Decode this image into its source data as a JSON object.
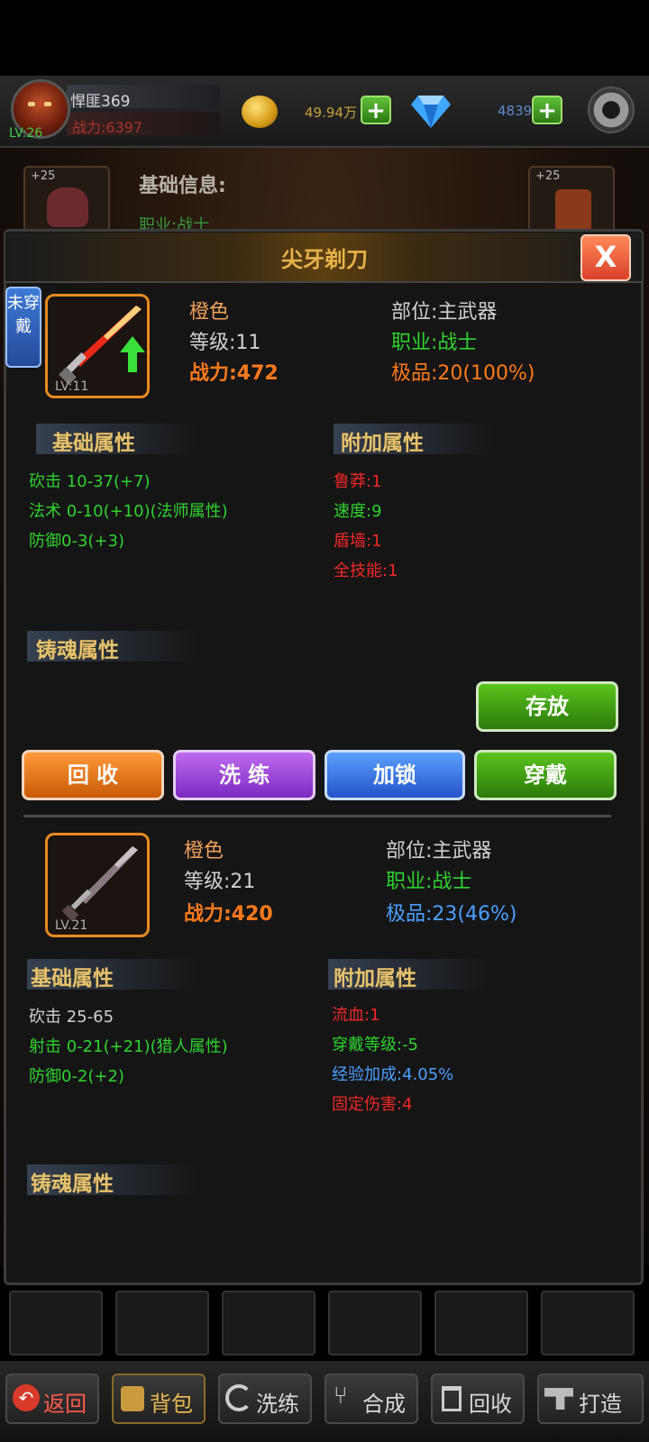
{
  "player": {
    "name": "悍匪369",
    "power": "战力:6397",
    "level": "LV:26"
  },
  "currency": {
    "gold": "49.94万",
    "diamonds": "4839",
    "plus_label": "+"
  },
  "background": {
    "title": "基础信息:",
    "subtitle": "职业:战士",
    "slot_bonus": "+25"
  },
  "panel": {
    "title": "尖牙剃刀",
    "close_label": "X",
    "unworn_tag": "未穿戴"
  },
  "item_new": {
    "level_badge": "LV:11",
    "quality": "橙色",
    "level": "等级:11",
    "power": "战力:472",
    "slot": "部位:主武器",
    "class": "职业:战士",
    "grade": "极品:20(100%)",
    "base_header": "基础属性",
    "extra_header": "附加属性",
    "soul_header": "铸魂属性",
    "base_attrs": [
      "砍击 10-37(+7)",
      "法术 0-10(+10)(法师属性)",
      "防御0-3(+3)"
    ],
    "extra_attrs": [
      {
        "text": "鲁莽:1",
        "color": "#f02828"
      },
      {
        "text": "速度:9",
        "color": "#2ed42e"
      },
      {
        "text": "盾墙:1",
        "color": "#f02828"
      },
      {
        "text": "全技能:1",
        "color": "#f02828"
      }
    ]
  },
  "actions": {
    "store": "存放",
    "recycle": "回 收",
    "refine": "洗 练",
    "lock": "加锁",
    "wear": "穿戴"
  },
  "item_equipped": {
    "level_badge": "LV.21",
    "quality": "橙色",
    "level": "等级:21",
    "power": "战力:420",
    "slot": "部位:主武器",
    "class": "职业:战士",
    "grade": "极品:23(46%)",
    "base_header": "基础属性",
    "extra_header": "附加属性",
    "soul_header": "铸魂属性",
    "base_attrs": [
      {
        "text": "砍击 25-65",
        "color": "#d0d0d0"
      },
      {
        "text": "射击 0-21(+21)(猎人属性)",
        "color": "#2ed42e"
      },
      {
        "text": "防御0-2(+2)",
        "color": "#2ed42e"
      }
    ],
    "extra_attrs": [
      {
        "text": "流血:1",
        "color": "#f02828"
      },
      {
        "text": "穿戴等级:-5",
        "color": "#2ed42e"
      },
      {
        "text": "经验加成:4.05%",
        "color": "#4aa0ff"
      },
      {
        "text": "固定伤害:4",
        "color": "#f02828"
      }
    ]
  },
  "nav": {
    "back": "返回",
    "bag": "背包",
    "refine": "洗练",
    "combine": "合成",
    "recycle": "回收",
    "forge": "打造"
  }
}
